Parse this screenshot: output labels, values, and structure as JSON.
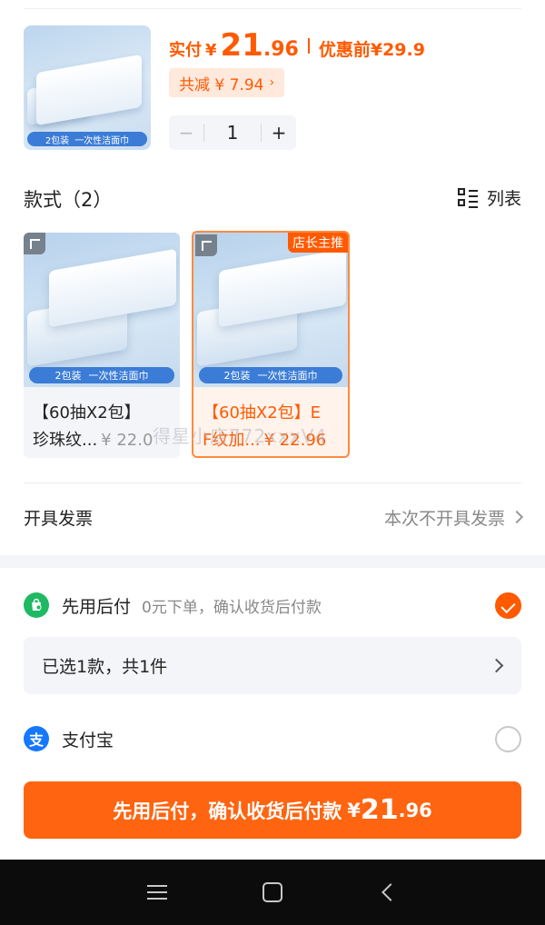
{
  "product": {
    "thumb_tag_a": "2包装",
    "thumb_tag_b": "一次性洁面巾",
    "paid_label": "实付",
    "currency": "¥",
    "price_int": "21",
    "price_dec": ".96",
    "before_label": "优惠前",
    "before_price": "¥29.9",
    "discount_text": "共减 ¥ 7.94",
    "quantity": "1",
    "minus": "−",
    "plus": "+"
  },
  "styles": {
    "title": "款式（2）",
    "list_label": "列表",
    "items": [
      {
        "tag_a": "2包装",
        "tag_b": "一次性洁面巾",
        "name_line1": "【60抽X2包】",
        "name_line2": "珍珠纹...",
        "price": "¥ 22.0",
        "selected": false
      },
      {
        "badge": "店长主推",
        "tag_a": "2包装",
        "tag_b": "一次性洁面巾",
        "name_line1": "【60抽X2包】E",
        "name_line2": "F纹加...",
        "price": "¥ 22.96",
        "selected": true
      }
    ],
    "watermark": "得星小店772xxxV4"
  },
  "invoice": {
    "label": "开具发票",
    "value": "本次不开具发票"
  },
  "payment": {
    "pay_later": {
      "name": "先用后付",
      "desc": "0元下单，确认收货后付款",
      "selected": true
    },
    "selection_summary": "已选1款，共1件",
    "alipay": {
      "icon_text": "支",
      "name": "支付宝",
      "selected": false
    }
  },
  "cta": {
    "text": "先用后付，确认收货后付款",
    "currency": "¥",
    "price_int": "21",
    "price_dec": ".96"
  },
  "colors": {
    "accent": "#ff5a00",
    "cta_bg": "#ff6410",
    "pay_later_icon": "#1fb863",
    "alipay_icon": "#1677ff"
  },
  "icons": [
    "minus-icon",
    "plus-icon",
    "list-icon",
    "expand-icon",
    "chevron-right-icon",
    "shopping-bag-icon",
    "alipay-icon",
    "menu-icon",
    "home-icon",
    "back-icon"
  ]
}
